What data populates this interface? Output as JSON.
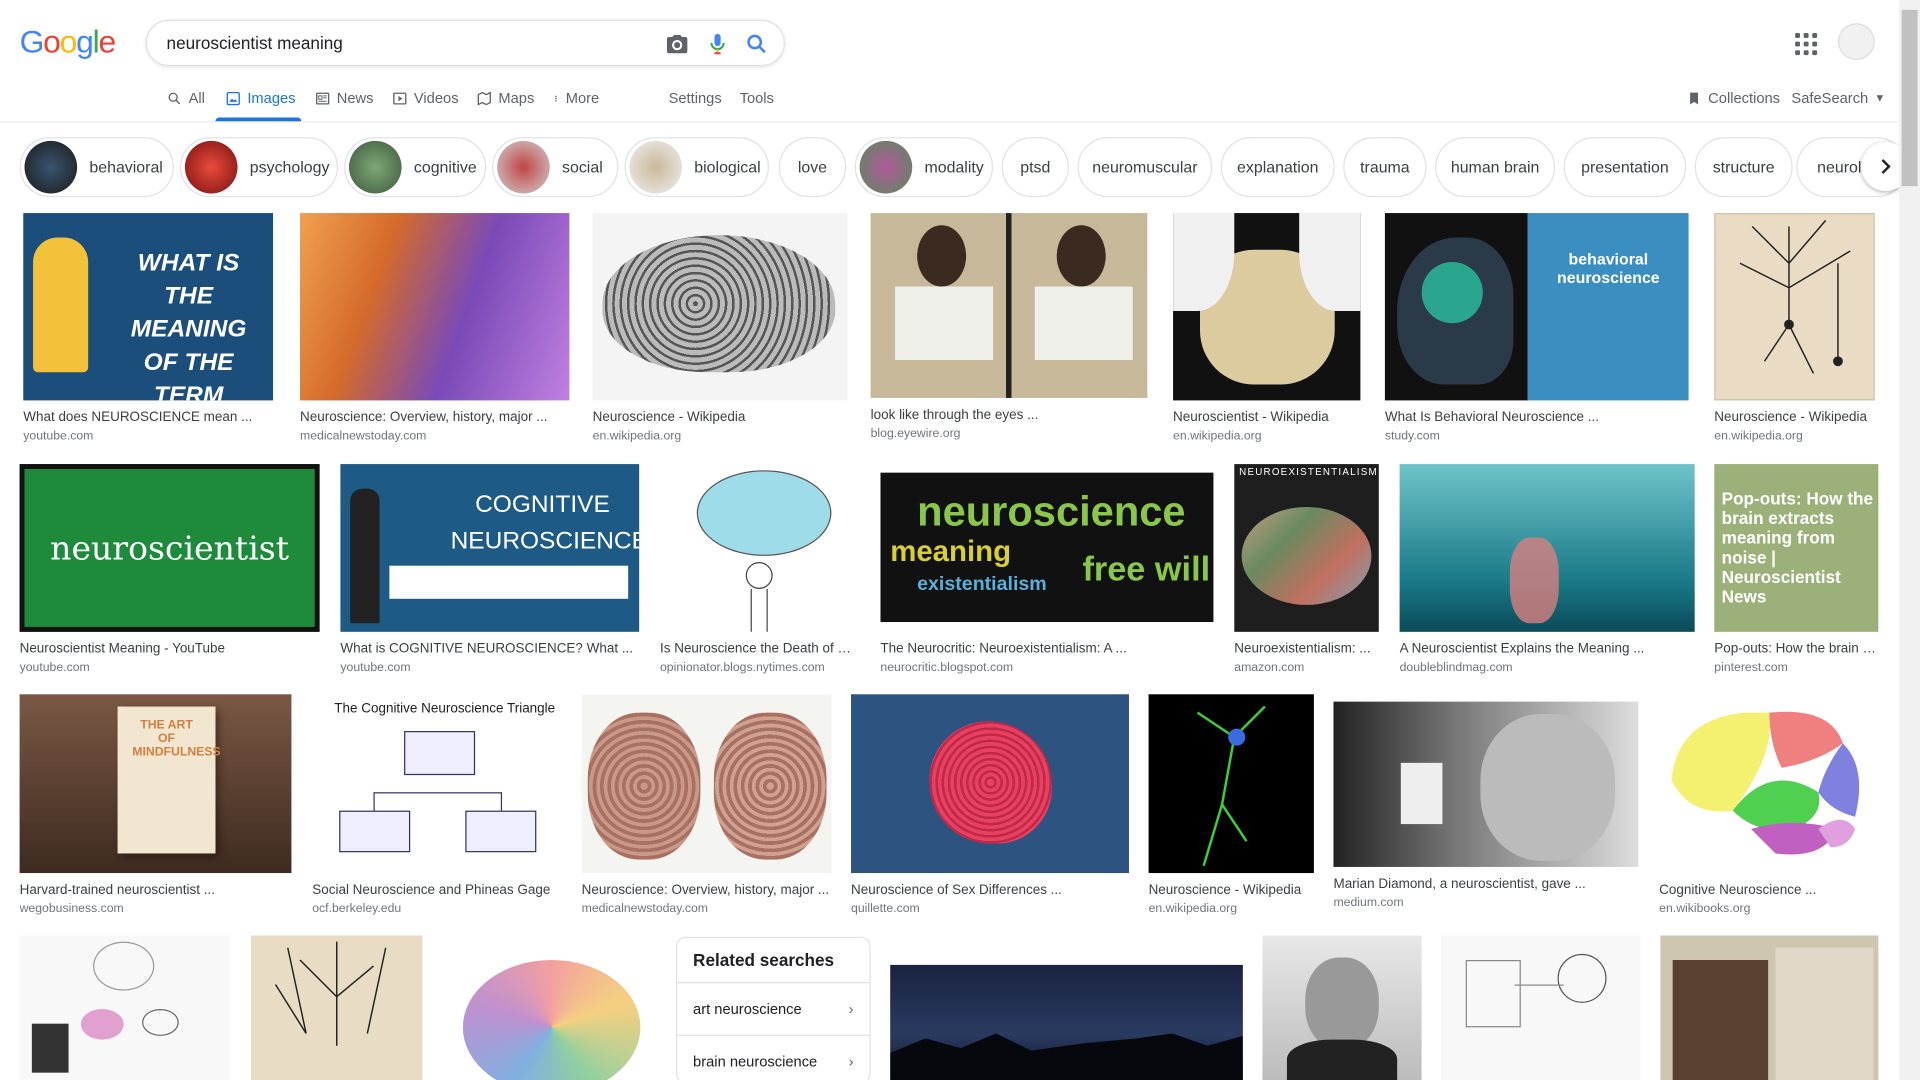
{
  "logo": [
    "G",
    "o",
    "o",
    "g",
    "l",
    "e"
  ],
  "search": {
    "query": "neuroscientist meaning"
  },
  "tabs": [
    {
      "label": "All",
      "icon": "search-icon"
    },
    {
      "label": "Images",
      "icon": "image-icon"
    },
    {
      "label": "News",
      "icon": "news-icon"
    },
    {
      "label": "Videos",
      "icon": "video-icon"
    },
    {
      "label": "Maps",
      "icon": "map-icon"
    },
    {
      "label": "More",
      "icon": "more-vert-icon"
    },
    {
      "label": "Settings"
    },
    {
      "label": "Tools"
    }
  ],
  "right_tools": {
    "collections": "Collections",
    "safesearch": "SafeSearch"
  },
  "chips": [
    "behavioral",
    "psychology",
    "cognitive",
    "social",
    "biological",
    "love",
    "modality",
    "ptsd",
    "neuromuscular",
    "explanation",
    "trauma",
    "human brain",
    "presentation",
    "structure",
    "neurolo"
  ],
  "results": [
    {
      "caption": "What does NEUROSCIENCE mean ...",
      "source": "youtube.com",
      "overlay": "WHAT IS THE MEANING OF THE TERM neuroscience",
      "color": "#1b4e7a"
    },
    {
      "caption": "Neuroscience: Overview, history, major ...",
      "source": "medicalnewstoday.com",
      "color": "#8a4bc0"
    },
    {
      "caption": "Neuroscience - Wikipedia",
      "source": "en.wikipedia.org",
      "color": "#d9d9d9"
    },
    {
      "caption": "look like through the eyes ...",
      "source": "blog.eyewire.org",
      "color": "#cbb79b"
    },
    {
      "caption": "Neuroscientist - Wikipedia",
      "source": "en.wikipedia.org",
      "color": "#d8c7a4"
    },
    {
      "caption": "What Is Behavioral Neuroscience ...",
      "source": "study.com",
      "overlay": "behavioral neuroscience",
      "color": "#1a1a1a"
    },
    {
      "caption": "Neuroscience - Wikipedia",
      "source": "en.wikipedia.org",
      "color": "#eadcc4"
    },
    {
      "caption": "Neuroscientist Meaning - YouTube",
      "source": "youtube.com",
      "overlay": "neuroscientist",
      "color": "#1e8a3c"
    },
    {
      "caption": "What is COGNITIVE NEUROSCIENCE? What ...",
      "source": "youtube.com",
      "overlay": "COGNITIVE NEUROSCIENCE",
      "color": "#1d5a86"
    },
    {
      "caption": "Is Neuroscience the Death of Fr...",
      "source": "opinionator.blogs.nytimes.com",
      "color": "#f2f2f2"
    },
    {
      "caption": "The Neurocritic: Neuroexistentialism: A ...",
      "source": "neurocritic.blogspot.com",
      "overlay": "neuroscience",
      "color": "#111111"
    },
    {
      "caption": "Neuroexistentialism: ...",
      "source": "amazon.com",
      "overlay": "NEUROEXISTENTIALISM",
      "color": "#1e1e1e"
    },
    {
      "caption": "A Neuroscientist Explains the Meaning ...",
      "source": "doubleblindmag.com",
      "color": "#2a8c95"
    },
    {
      "caption": "Pop-outs: How the brain e...",
      "source": "pinterest.com",
      "overlay": "Pop-outs: How the brain extracts meaning from noise | Neuroscientist News",
      "color": "#9cb07a"
    },
    {
      "caption": "Harvard-trained neuroscientist ...",
      "source": "wegobusiness.com",
      "color": "#6f4e3a"
    },
    {
      "caption": "Social Neuroscience and Phineas Gage",
      "source": "ocf.berkeley.edu",
      "overlay": "The Cognitive Neuroscience Triangle",
      "color": "#ffffff"
    },
    {
      "caption": "Neuroscience: Overview, history, major ...",
      "source": "medicalnewstoday.com",
      "color": "#ead8cc"
    },
    {
      "caption": "Neuroscience of Sex Differences ...",
      "source": "quillette.com",
      "color": "#2d5380"
    },
    {
      "caption": "Neuroscience - Wikipedia",
      "source": "en.wikipedia.org",
      "color": "#000000"
    },
    {
      "caption": "Marian Diamond, a neuroscientist, gave ...",
      "source": "medium.com",
      "color": "#555555"
    },
    {
      "caption": "Cognitive Neuroscience ...",
      "source": "en.wikibooks.org",
      "color": "#ffffff"
    },
    {
      "caption": "",
      "source": "",
      "color": "#f4f4f4"
    },
    {
      "caption": "",
      "source": "",
      "color": "#e8dcc4"
    },
    {
      "caption": "",
      "source": "",
      "color": "#ffffff"
    },
    {
      "caption": "",
      "source": "",
      "color": "#1e2a44"
    },
    {
      "caption": "",
      "source": "",
      "color": "#d9d9d9"
    },
    {
      "caption": "",
      "source": "",
      "color": "#f7f7f7"
    },
    {
      "caption": "",
      "source": "",
      "color": "#cfc6b2"
    }
  ],
  "related": {
    "title": "Related searches",
    "items": [
      "art neuroscience",
      "brain neuroscience"
    ]
  }
}
